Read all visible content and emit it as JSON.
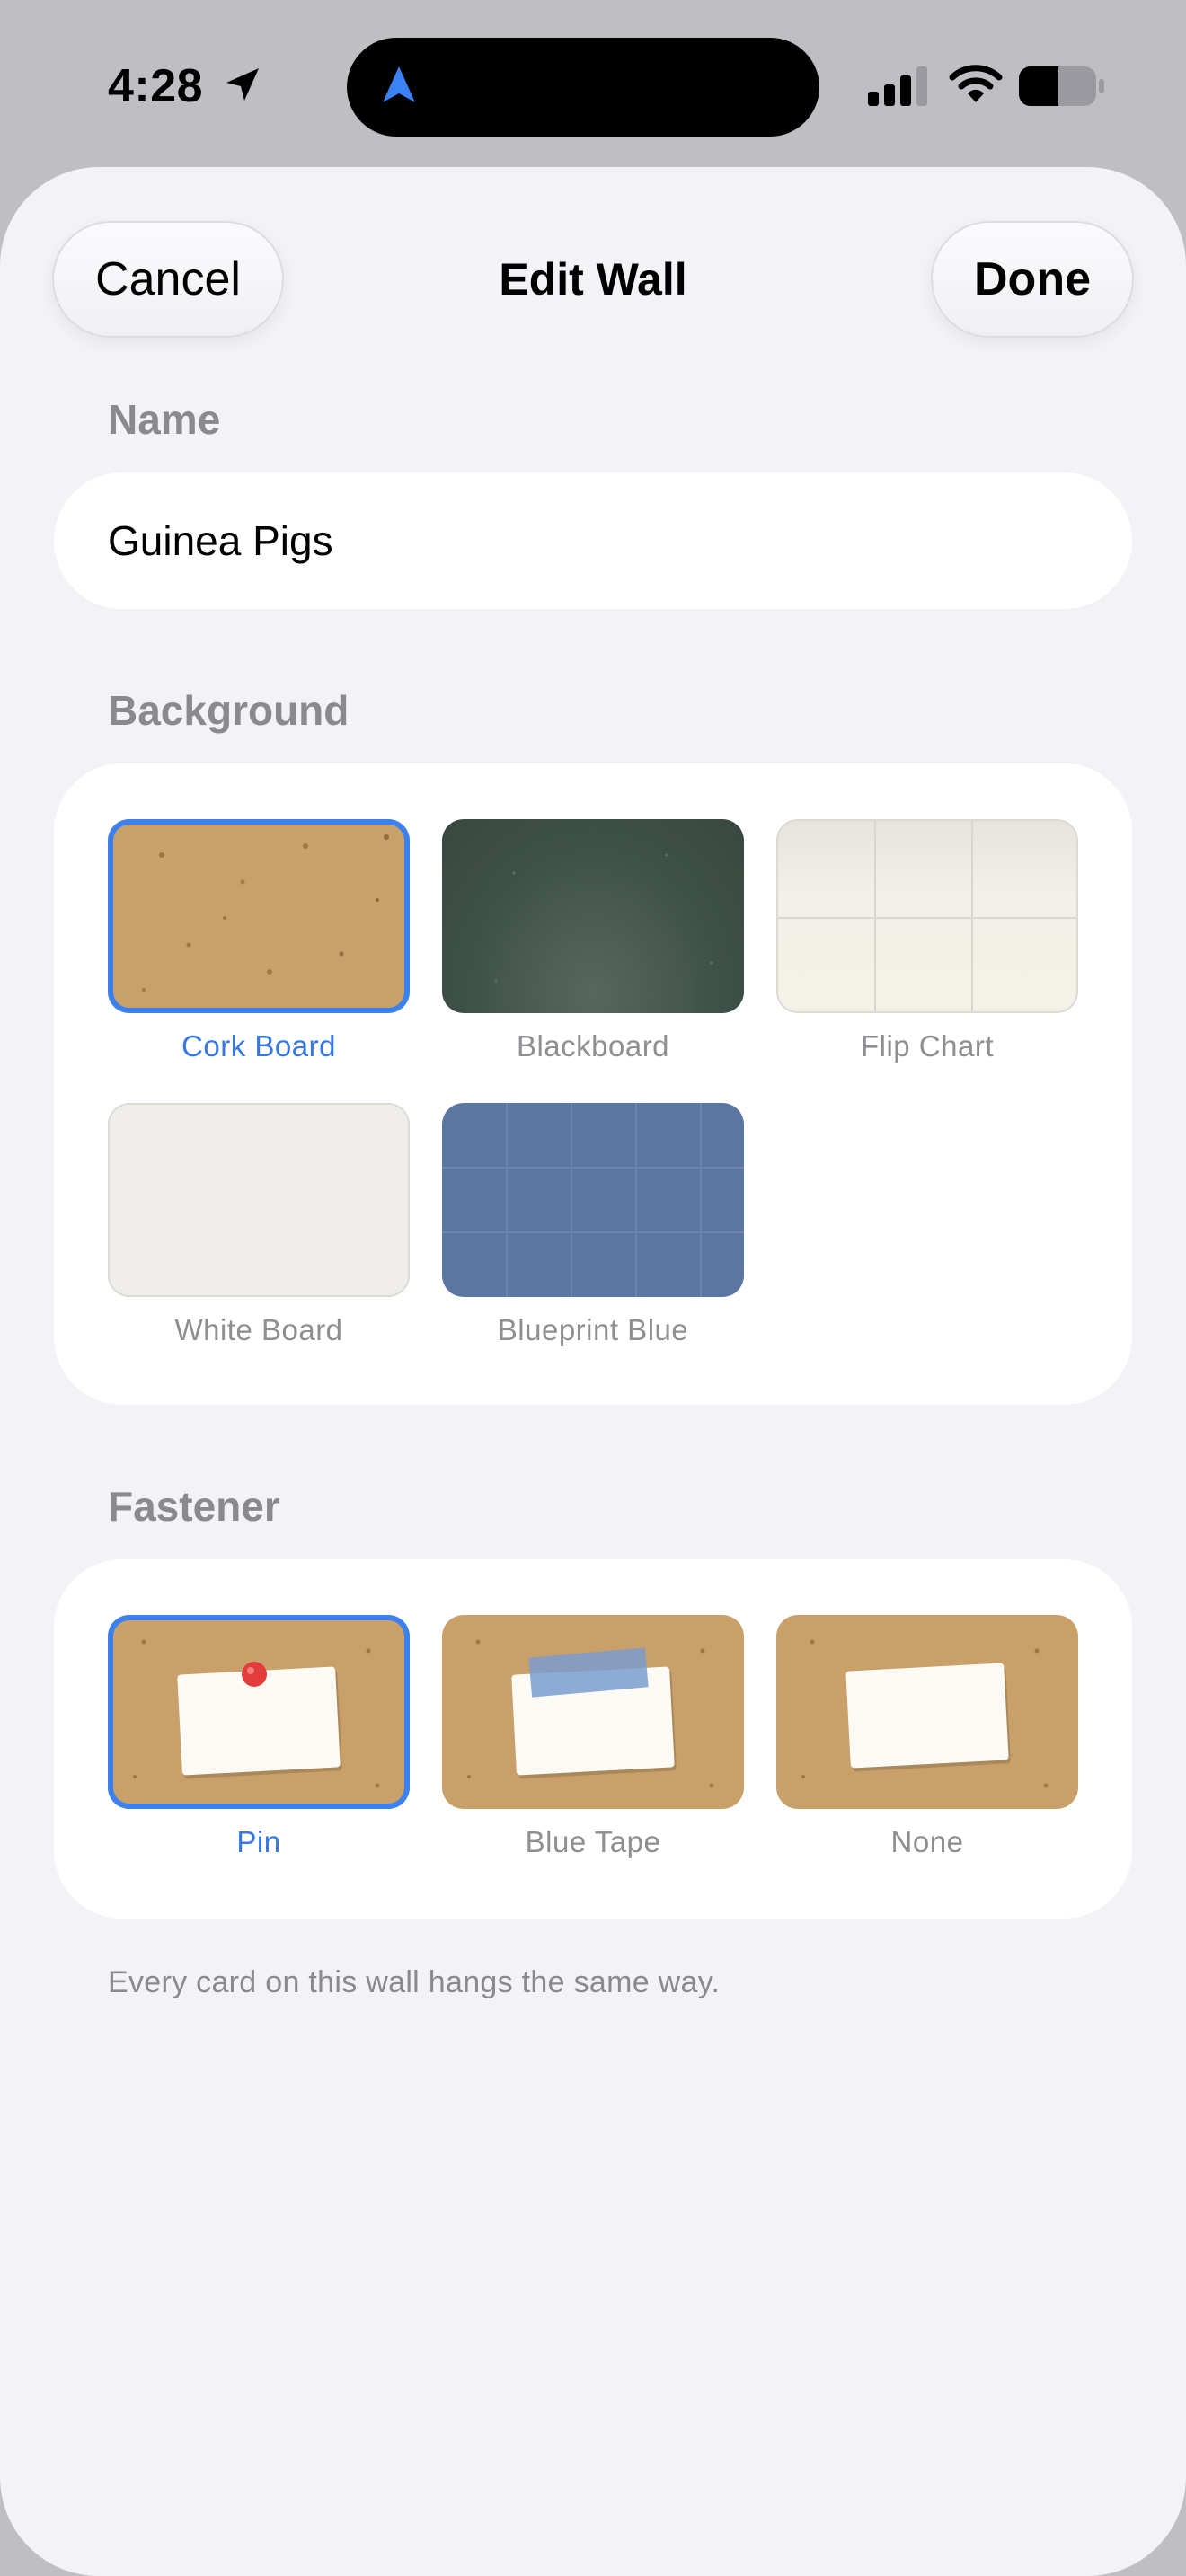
{
  "status_bar": {
    "time": "4:28",
    "icons": [
      "location-arrow-icon",
      "navigation-icon",
      "signal-icon",
      "wifi-icon",
      "battery-icon"
    ]
  },
  "nav": {
    "cancel_label": "Cancel",
    "title": "Edit Wall",
    "done_label": "Done"
  },
  "name_section": {
    "label": "Name",
    "value": "Guinea Pigs"
  },
  "background_section": {
    "label": "Background",
    "options": [
      {
        "label": "Cork Board",
        "selected": true
      },
      {
        "label": "Blackboard",
        "selected": false
      },
      {
        "label": "Flip Chart",
        "selected": false
      },
      {
        "label": "White Board",
        "selected": false
      },
      {
        "label": "Blueprint Blue",
        "selected": false
      }
    ]
  },
  "fastener_section": {
    "label": "Fastener",
    "options": [
      {
        "label": "Pin",
        "selected": true
      },
      {
        "label": "Blue Tape",
        "selected": false
      },
      {
        "label": "None",
        "selected": false
      }
    ],
    "footnote": "Every card on this wall hangs the same way."
  },
  "colors": {
    "accent": "#3578E5",
    "cork": "#C9A06A",
    "blackboard": "#3E5148",
    "blueprint": "#5C76A2"
  }
}
